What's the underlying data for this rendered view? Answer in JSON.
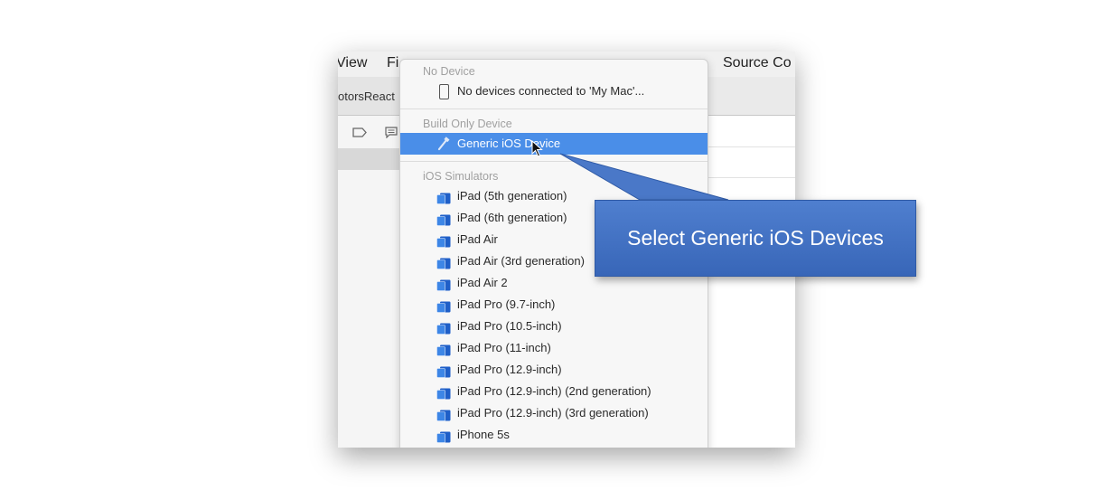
{
  "menubar": {
    "view": "View",
    "file": "Fi",
    "source_control": "Source Co"
  },
  "toolbar": {
    "scheme": "otorsReact"
  },
  "dropdown": {
    "no_device_header": "No Device",
    "no_device_item": "No devices connected to 'My Mac'...",
    "build_only_header": "Build Only Device",
    "generic_item": "Generic iOS Device",
    "simulators_header": "iOS Simulators",
    "simulators": [
      "iPad (5th generation)",
      "iPad (6th generation)",
      "iPad Air",
      "iPad Air (3rd generation)",
      "iPad Air 2",
      "iPad Pro (9.7-inch)",
      "iPad Pro (10.5-inch)",
      "iPad Pro (11-inch)",
      "iPad Pro (12.9-inch)",
      "iPad Pro (12.9-inch) (2nd generation)",
      "iPad Pro (12.9-inch) (3rd generation)",
      "iPhone 5s"
    ]
  },
  "callout": {
    "text": "Select Generic iOS Devices"
  },
  "colors": {
    "selection": "#4a8ee8",
    "callout": "#3f6fc2",
    "simulator_icon": "#2f6fd6"
  },
  "icons": {
    "device": "phone-icon",
    "generic": "hammer-icon",
    "simulator": "simulator-icon",
    "cursor": "cursor-icon"
  }
}
